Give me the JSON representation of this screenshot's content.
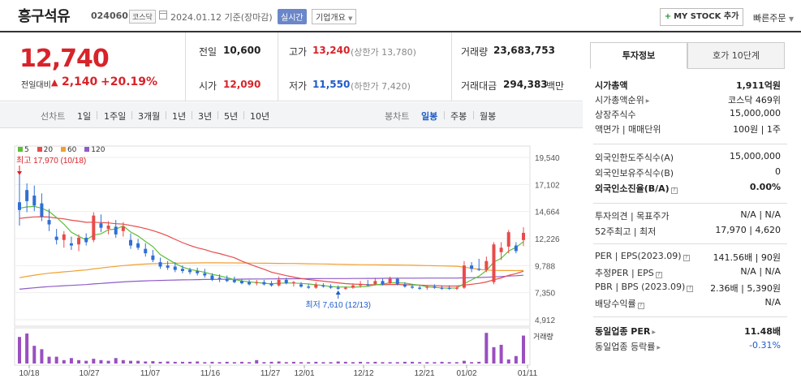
{
  "header": {
    "stock_name": "흥구석유",
    "stock_code": "024060",
    "market": "코스닥",
    "date_text": "2024.01.12  기준(장마감)",
    "realtime_label": "실시간",
    "overview_label": "기업개요",
    "mystock_label": "MY STOCK 추가",
    "quick_order_label": "빠른주문"
  },
  "price": {
    "current": "12,740",
    "change_label": "전일대비",
    "change_value": "2,140",
    "change_rate": "+20.19%"
  },
  "quotes": {
    "prev_close_label": "전일",
    "prev_close": "10,600",
    "high_label": "고가",
    "high": "13,240",
    "upper_limit_text": "(상한가 13,780)",
    "volume_label": "거래량",
    "volume": "23,683,753",
    "open_label": "시가",
    "open": "12,090",
    "low_label": "저가",
    "low": "11,550",
    "lower_limit_text": "(하한가 7,420)",
    "amount_label": "거래대금",
    "amount": "294,383",
    "amount_unit": "백만"
  },
  "toolbar": {
    "line_chart_label": "선차트",
    "periods": [
      "1일",
      "1주일",
      "3개월",
      "1년",
      "3년",
      "5년",
      "10년"
    ],
    "candle_chart_label": "봉차트",
    "candle_periods": [
      "일봉",
      "주봉",
      "월봉"
    ],
    "active_candle": "일봉"
  },
  "chart_data": {
    "type": "candlestick",
    "legend": [
      "5",
      "20",
      "60",
      "120"
    ],
    "colors": {
      "ma5": "#5cbf3a",
      "ma20": "#e84b4b",
      "ma60": "#f0a030",
      "ma120": "#8e5bc8",
      "up": "#e84b4b",
      "down": "#2f6fd6"
    },
    "y_ticks": [
      "19,540",
      "17,102",
      "14,664",
      "12,226",
      "9,788",
      "7,350",
      "4,912"
    ],
    "x_ticks": [
      "10/18",
      "10/27",
      "11/07",
      "11/16",
      "11/27",
      "12/01",
      "12/12",
      "12/21",
      "01/02",
      "01/11"
    ],
    "high_annotation": "최고 17,970 (10/18)",
    "low_annotation": "최저 7,610 (12/13)",
    "volume_label": "거래량",
    "ylim": [
      4912,
      19540
    ],
    "candles": [
      {
        "o": 15500,
        "h": 17970,
        "l": 13400,
        "c": 14800
      },
      {
        "o": 16600,
        "h": 17200,
        "l": 14600,
        "c": 15600
      },
      {
        "o": 16100,
        "h": 17000,
        "l": 14700,
        "c": 15200
      },
      {
        "o": 15400,
        "h": 16300,
        "l": 13800,
        "c": 14200
      },
      {
        "o": 13900,
        "h": 14900,
        "l": 12900,
        "c": 13500
      },
      {
        "o": 12400,
        "h": 13100,
        "l": 11700,
        "c": 12100
      },
      {
        "o": 12100,
        "h": 12900,
        "l": 11400,
        "c": 12600
      },
      {
        "o": 11800,
        "h": 12400,
        "l": 11200,
        "c": 11600
      },
      {
        "o": 11700,
        "h": 12600,
        "l": 11100,
        "c": 12300
      },
      {
        "o": 12300,
        "h": 12700,
        "l": 11600,
        "c": 11900
      },
      {
        "o": 12100,
        "h": 14600,
        "l": 11900,
        "c": 14300
      },
      {
        "o": 13600,
        "h": 14400,
        "l": 12800,
        "c": 13200
      },
      {
        "o": 13100,
        "h": 13800,
        "l": 12600,
        "c": 13400
      },
      {
        "o": 13300,
        "h": 13900,
        "l": 12300,
        "c": 12600
      },
      {
        "o": 12900,
        "h": 13700,
        "l": 12400,
        "c": 13300
      },
      {
        "o": 12100,
        "h": 12700,
        "l": 11300,
        "c": 11600
      },
      {
        "o": 11800,
        "h": 12200,
        "l": 11200,
        "c": 11400
      },
      {
        "o": 11300,
        "h": 11800,
        "l": 10600,
        "c": 10900
      },
      {
        "o": 10700,
        "h": 11200,
        "l": 10100,
        "c": 10300
      },
      {
        "o": 10100,
        "h": 10500,
        "l": 9500,
        "c": 9700
      },
      {
        "o": 9800,
        "h": 10200,
        "l": 9400,
        "c": 9600
      },
      {
        "o": 9700,
        "h": 10100,
        "l": 9200,
        "c": 9400
      },
      {
        "o": 9500,
        "h": 9800,
        "l": 9100,
        "c": 9300
      },
      {
        "o": 9400,
        "h": 9600,
        "l": 9000,
        "c": 9200
      },
      {
        "o": 9300,
        "h": 9600,
        "l": 8900,
        "c": 9100
      },
      {
        "o": 9100,
        "h": 9500,
        "l": 8700,
        "c": 8900
      },
      {
        "o": 8900,
        "h": 9100,
        "l": 8400,
        "c": 8500
      },
      {
        "o": 8700,
        "h": 9000,
        "l": 8300,
        "c": 8600
      },
      {
        "o": 8600,
        "h": 8900,
        "l": 8300,
        "c": 8400
      },
      {
        "o": 8500,
        "h": 8800,
        "l": 8200,
        "c": 8300
      },
      {
        "o": 8400,
        "h": 8600,
        "l": 8100,
        "c": 8200
      },
      {
        "o": 8300,
        "h": 8500,
        "l": 8000,
        "c": 8100
      },
      {
        "o": 8200,
        "h": 8500,
        "l": 8000,
        "c": 8300
      },
      {
        "o": 8300,
        "h": 8500,
        "l": 8000,
        "c": 8100
      },
      {
        "o": 8200,
        "h": 8400,
        "l": 7900,
        "c": 8000
      },
      {
        "o": 8000,
        "h": 8800,
        "l": 7900,
        "c": 8500
      },
      {
        "o": 8500,
        "h": 8700,
        "l": 8100,
        "c": 8200
      },
      {
        "o": 8200,
        "h": 8400,
        "l": 7900,
        "c": 8300
      },
      {
        "o": 8100,
        "h": 8300,
        "l": 7800,
        "c": 7900
      },
      {
        "o": 7900,
        "h": 8100,
        "l": 7700,
        "c": 7800
      },
      {
        "o": 7800,
        "h": 8300,
        "l": 7700,
        "c": 8100
      },
      {
        "o": 8000,
        "h": 8200,
        "l": 7800,
        "c": 7900
      },
      {
        "o": 7900,
        "h": 8100,
        "l": 7700,
        "c": 7800
      },
      {
        "o": 7800,
        "h": 8000,
        "l": 7610,
        "c": 7700
      },
      {
        "o": 7700,
        "h": 7900,
        "l": 7610,
        "c": 7800
      },
      {
        "o": 7800,
        "h": 8200,
        "l": 7700,
        "c": 8000
      },
      {
        "o": 8000,
        "h": 8400,
        "l": 7800,
        "c": 8100
      },
      {
        "o": 8100,
        "h": 8500,
        "l": 7900,
        "c": 8000
      },
      {
        "o": 8100,
        "h": 8700,
        "l": 8000,
        "c": 8400
      },
      {
        "o": 8400,
        "h": 8600,
        "l": 8000,
        "c": 8100
      },
      {
        "o": 8200,
        "h": 8800,
        "l": 8100,
        "c": 8600
      },
      {
        "o": 8600,
        "h": 8700,
        "l": 8000,
        "c": 8100
      },
      {
        "o": 8100,
        "h": 8300,
        "l": 7800,
        "c": 7900
      },
      {
        "o": 7900,
        "h": 8100,
        "l": 7700,
        "c": 7800
      },
      {
        "o": 7800,
        "h": 8000,
        "l": 7600,
        "c": 7700
      },
      {
        "o": 7800,
        "h": 8000,
        "l": 7600,
        "c": 7900
      },
      {
        "o": 7900,
        "h": 8100,
        "l": 7700,
        "c": 7800
      },
      {
        "o": 7800,
        "h": 8000,
        "l": 7600,
        "c": 7700
      },
      {
        "o": 7800,
        "h": 8000,
        "l": 7600,
        "c": 7700
      },
      {
        "o": 7700,
        "h": 7900,
        "l": 7600,
        "c": 7800
      },
      {
        "o": 7800,
        "h": 10200,
        "l": 7700,
        "c": 9800
      },
      {
        "o": 9800,
        "h": 10100,
        "l": 9200,
        "c": 9500
      },
      {
        "o": 9500,
        "h": 10400,
        "l": 9300,
        "c": 9400
      },
      {
        "o": 9400,
        "h": 10600,
        "l": 9200,
        "c": 10200
      },
      {
        "o": 8300,
        "h": 11900,
        "l": 8100,
        "c": 11700
      },
      {
        "o": 11000,
        "h": 11900,
        "l": 10300,
        "c": 11400
      },
      {
        "o": 11500,
        "h": 13000,
        "l": 10900,
        "c": 12800
      },
      {
        "o": 11600,
        "h": 11900,
        "l": 10900,
        "c": 11100
      },
      {
        "o": 12090,
        "h": 13240,
        "l": 11550,
        "c": 12740
      }
    ],
    "volumes": [
      0.78,
      0.88,
      0.52,
      0.42,
      0.2,
      0.2,
      0.1,
      0.16,
      0.1,
      0.08,
      0.14,
      0.1,
      0.08,
      0.16,
      0.1,
      0.08,
      0.08,
      0.06,
      0.07,
      0.05,
      0.06,
      0.05,
      0.05,
      0.05,
      0.06,
      0.04,
      0.05,
      0.04,
      0.05,
      0.04,
      0.05,
      0.04,
      0.1,
      0.04,
      0.05,
      0.06,
      0.04,
      0.05,
      0.04,
      0.04,
      0.05,
      0.04,
      0.04,
      0.06,
      0.05,
      0.04,
      0.05,
      0.04,
      0.05,
      0.04,
      0.04,
      0.04,
      0.05,
      0.05,
      0.04,
      0.04,
      0.04,
      0.05,
      0.04,
      0.04,
      0.08,
      0.04,
      0.05,
      0.9,
      0.48,
      0.55,
      0.12,
      0.22,
      0.82
    ]
  },
  "right_panel": {
    "tabs": [
      "투자정보",
      "호가 10단계"
    ],
    "market_cap_label": "시가총액",
    "market_cap": "1,911억원",
    "market_cap_rank_label": "시가총액순위",
    "market_cap_rank": "코스닥 469위",
    "shares_label": "상장주식수",
    "shares": "15,000,000",
    "face_value_label": "액면가 | 매매단위",
    "face_value": "100원 | 1주",
    "foreign_limit_label": "외국인한도주식수(A)",
    "foreign_limit": "15,000,000",
    "foreign_hold_label": "외국인보유주식수(B)",
    "foreign_hold": "0",
    "foreign_ratio_label": "외국인소진율(B/A)",
    "foreign_ratio": "0.00%",
    "opinion_label": "투자의견 | 목표주가",
    "opinion": "N/A | N/A",
    "week52_label": "52주최고 | 최저",
    "week52": "17,970 | 4,620",
    "per_label": "PER | EPS(2023.09)",
    "per": "141.56배 | 90원",
    "est_per_label": "추정PER | EPS",
    "est_per": "N/A | N/A",
    "pbr_label": "PBR | BPS (2023.09)",
    "pbr": "2.36배 | 5,390원",
    "dividend_label": "배당수익률",
    "dividend": "N/A",
    "industry_per_label": "동일업종 PER",
    "industry_per": "11.48배",
    "industry_rate_label": "동일업종 등락률",
    "industry_rate": "-0.31%"
  }
}
